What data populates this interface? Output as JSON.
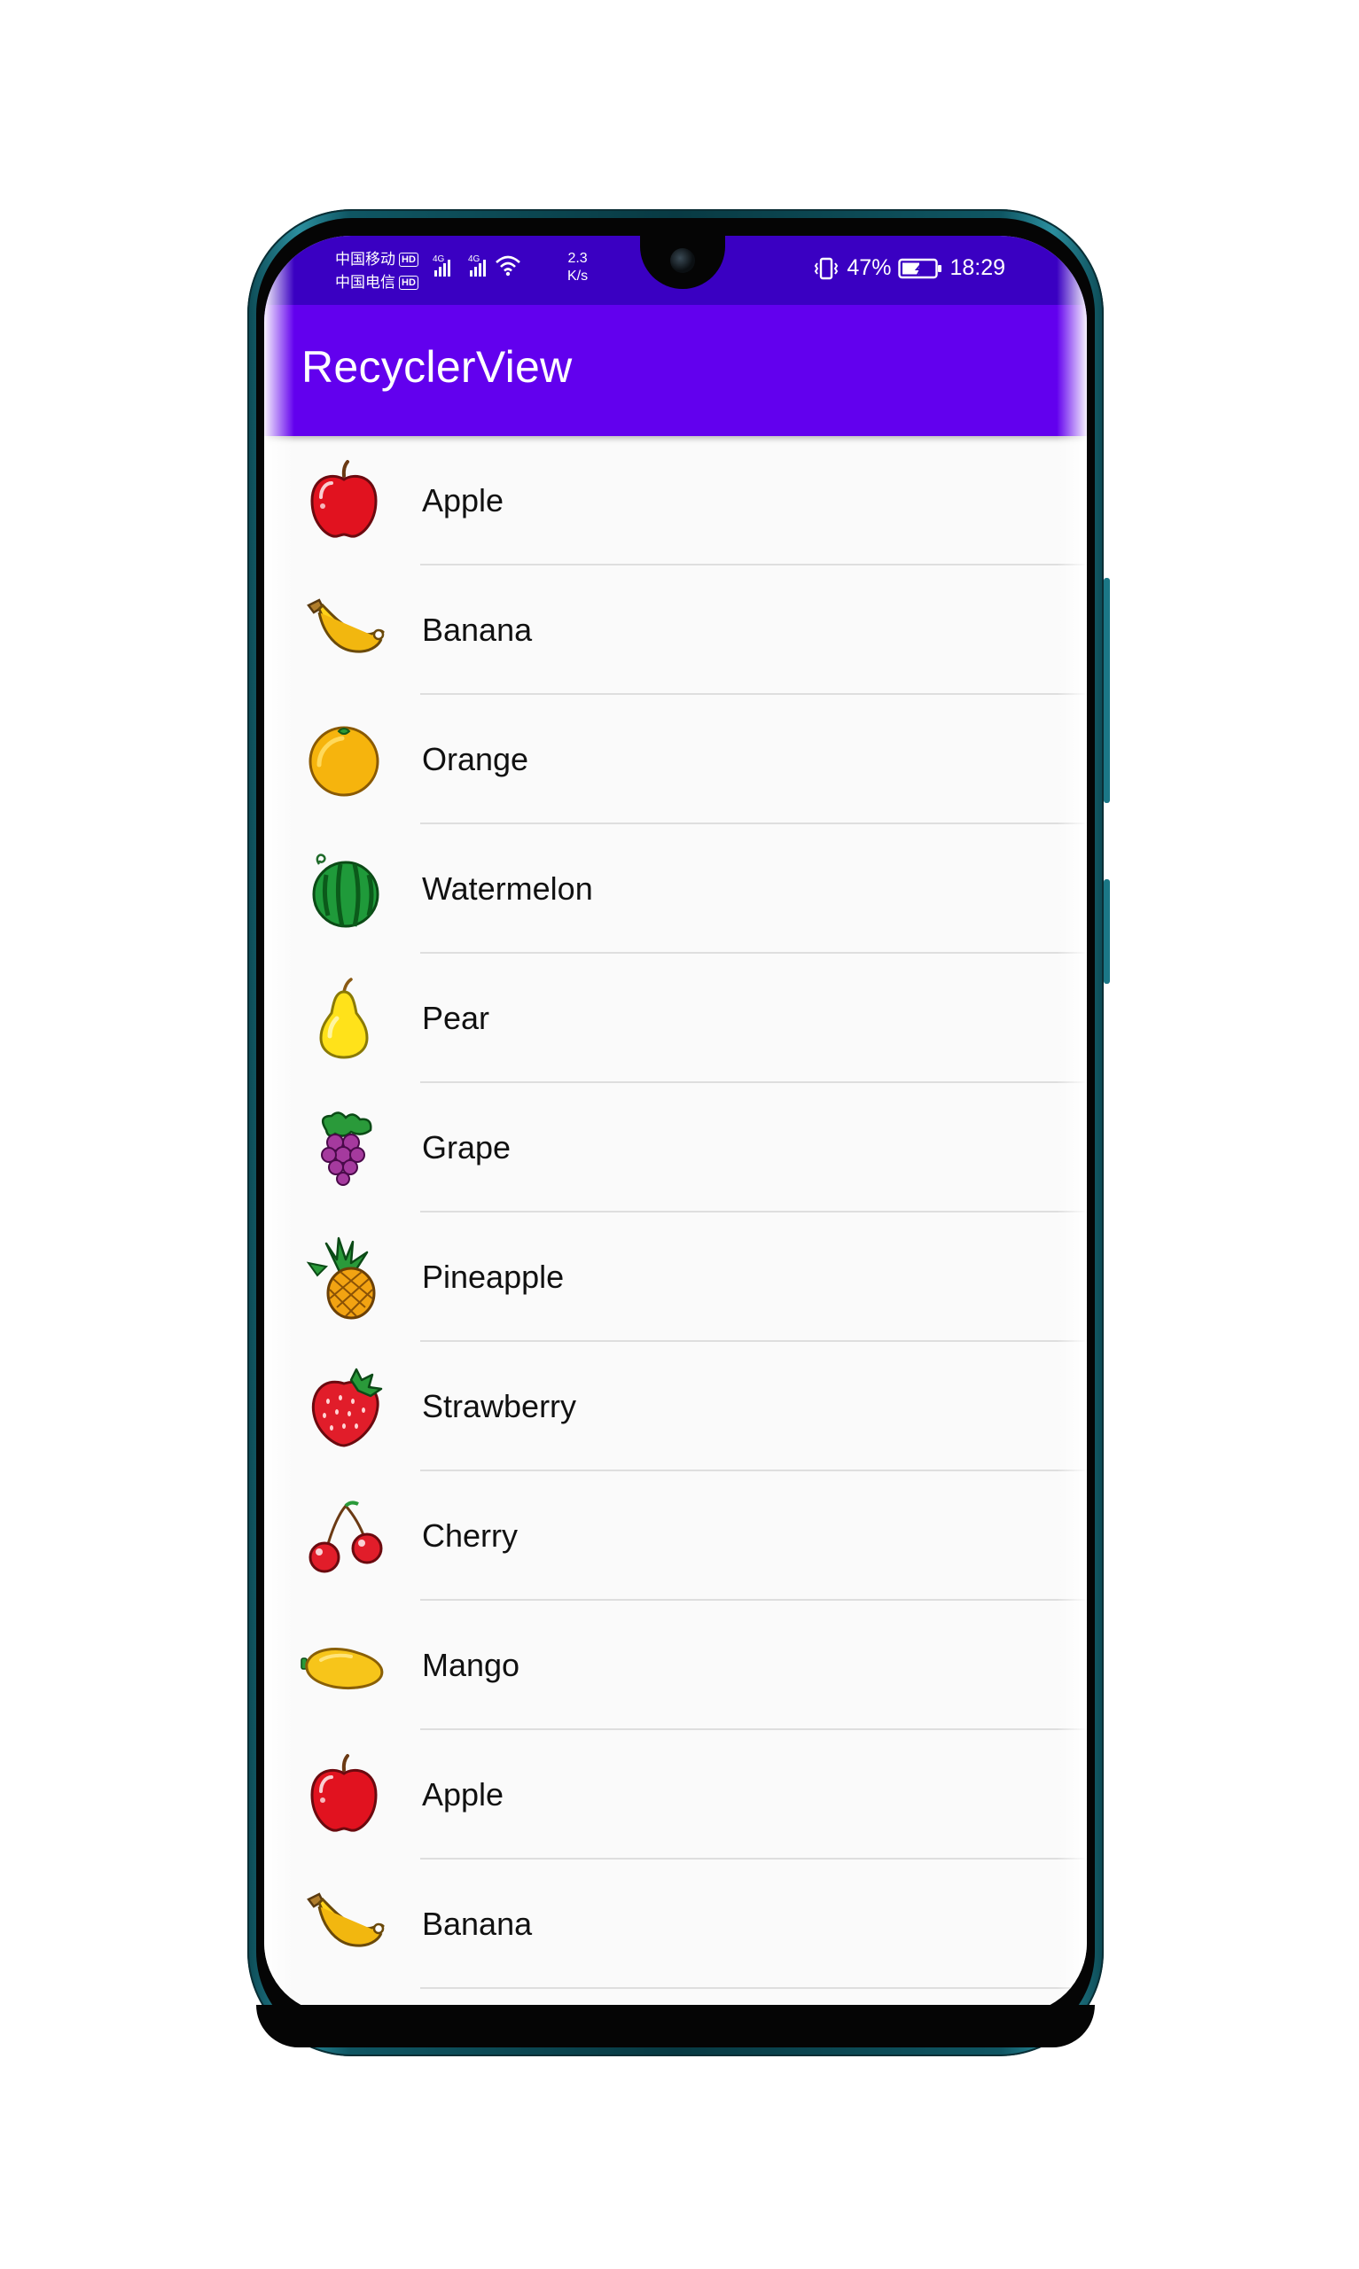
{
  "status_bar": {
    "carrier_1": "中国移动",
    "carrier_2": "中国电信",
    "hd_badge": "HD",
    "network_type": "4G",
    "speed_value": "2.3",
    "speed_unit": "K/s",
    "battery_percent": "47%",
    "time": "18:29"
  },
  "app_bar": {
    "title": "RecyclerView",
    "color": "#6200ee",
    "status_color": "#3a00c2"
  },
  "list": {
    "items": [
      {
        "label": "Apple",
        "icon": "apple-icon"
      },
      {
        "label": "Banana",
        "icon": "banana-icon"
      },
      {
        "label": "Orange",
        "icon": "orange-icon"
      },
      {
        "label": "Watermelon",
        "icon": "watermelon-icon"
      },
      {
        "label": "Pear",
        "icon": "pear-icon"
      },
      {
        "label": "Grape",
        "icon": "grape-icon"
      },
      {
        "label": "Pineapple",
        "icon": "pineapple-icon"
      },
      {
        "label": "Strawberry",
        "icon": "strawberry-icon"
      },
      {
        "label": "Cherry",
        "icon": "cherry-icon"
      },
      {
        "label": "Mango",
        "icon": "mango-icon"
      },
      {
        "label": "Apple",
        "icon": "apple-icon"
      },
      {
        "label": "Banana",
        "icon": "banana-icon"
      }
    ]
  }
}
